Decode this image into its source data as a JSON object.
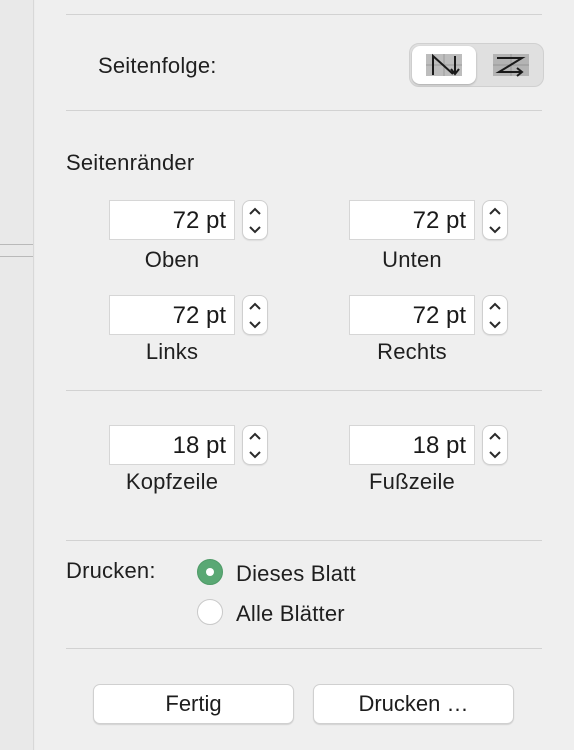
{
  "page_order": {
    "label": "Seitenfolge:",
    "options": [
      {
        "icon": "down-then-over-icon",
        "selected": true
      },
      {
        "icon": "over-then-down-icon",
        "selected": false
      }
    ]
  },
  "margins": {
    "heading": "Seitenränder",
    "top": {
      "value": "72 pt",
      "label": "Oben"
    },
    "bottom": {
      "value": "72 pt",
      "label": "Unten"
    },
    "left": {
      "value": "72 pt",
      "label": "Links"
    },
    "right": {
      "value": "72 pt",
      "label": "Rechts"
    }
  },
  "header_footer": {
    "header": {
      "value": "18 pt",
      "label": "Kopfzeile"
    },
    "footer": {
      "value": "18 pt",
      "label": "Fußzeile"
    }
  },
  "print_scope": {
    "label": "Drucken:",
    "options": [
      {
        "label": "Dieses Blatt",
        "selected": true
      },
      {
        "label": "Alle Blätter",
        "selected": false
      }
    ],
    "accent": "#5aa874"
  },
  "buttons": {
    "done": "Fertig",
    "print": "Drucken …"
  }
}
